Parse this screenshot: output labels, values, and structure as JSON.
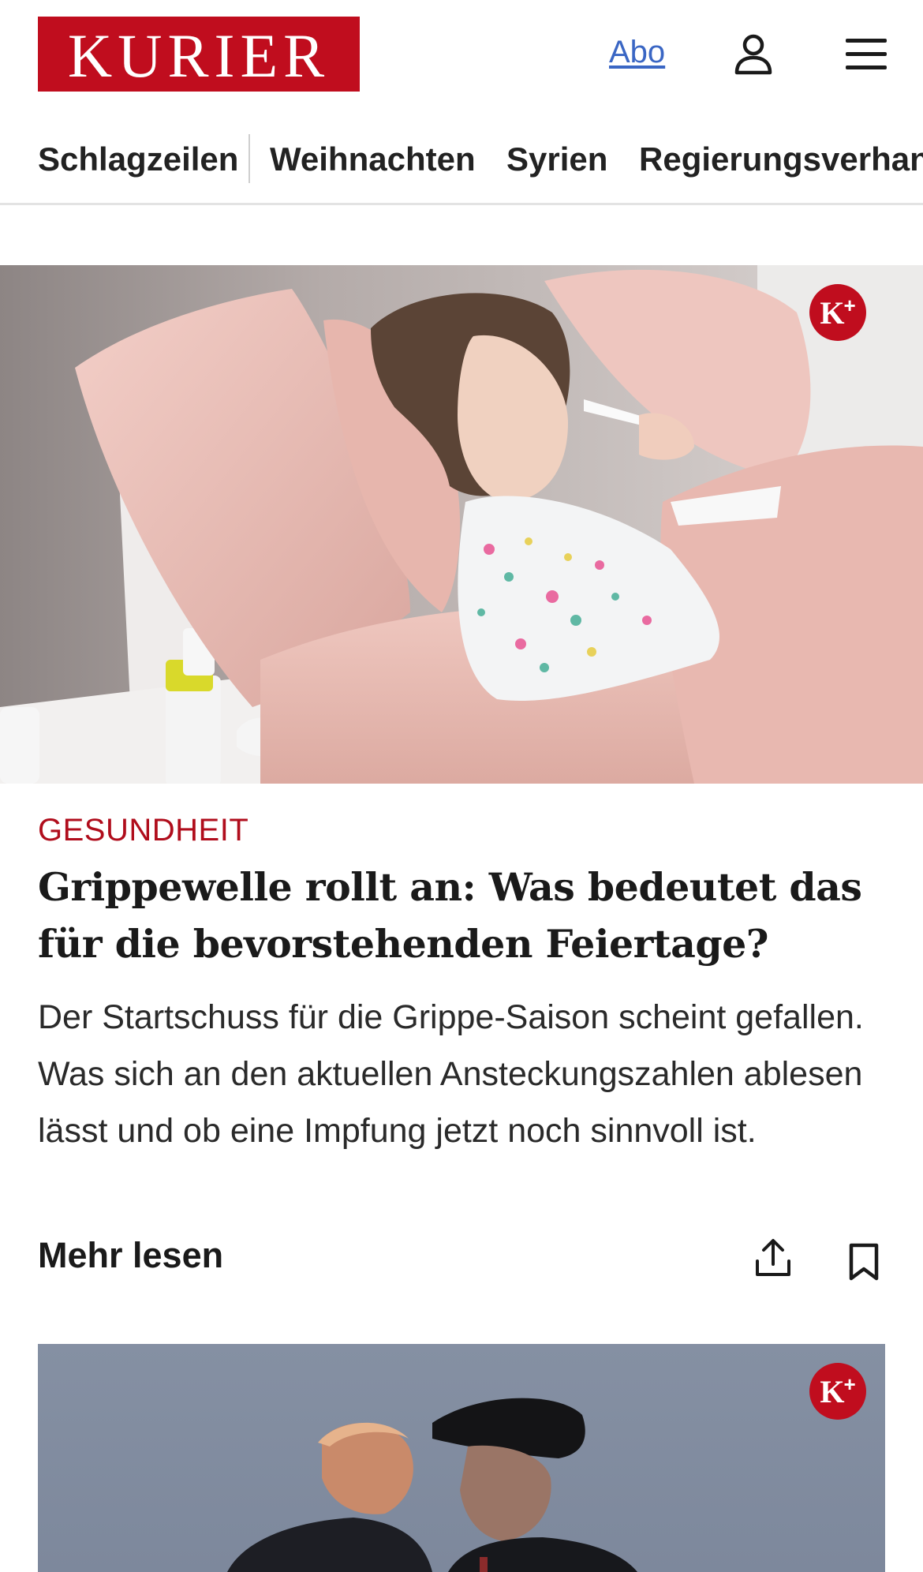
{
  "header": {
    "logo_text": "KURIER",
    "abo_label": "Abo",
    "user_icon": "user-icon",
    "menu_icon": "hamburger-menu-icon",
    "brand_color": "#c00d1e"
  },
  "nav": {
    "items": [
      {
        "label": "Schlagzeilen"
      },
      {
        "label": "Weihnachten"
      },
      {
        "label": "Syrien"
      },
      {
        "label": "Regierungsverhand"
      }
    ]
  },
  "article": {
    "premium_badge": "K",
    "premium_plus": "+",
    "kicker": "GESUNDHEIT",
    "headline": "Grippewelle rollt an: Was bedeutet das für die bevorstehenden Feiertage?",
    "teaser": "Der Startschuss für die Grippe-Saison scheint gefallen. Was sich an den aktuellen Ansteckungszahlen ablesen lässt und ob eine Impfung jetzt noch sinnvoll ist.",
    "more_label": "Mehr lesen",
    "share_icon": "share-icon",
    "bookmark_icon": "bookmark-icon",
    "kicker_color": "#b00d1c"
  },
  "next_article": {
    "premium_badge": "K",
    "premium_plus": "+"
  }
}
